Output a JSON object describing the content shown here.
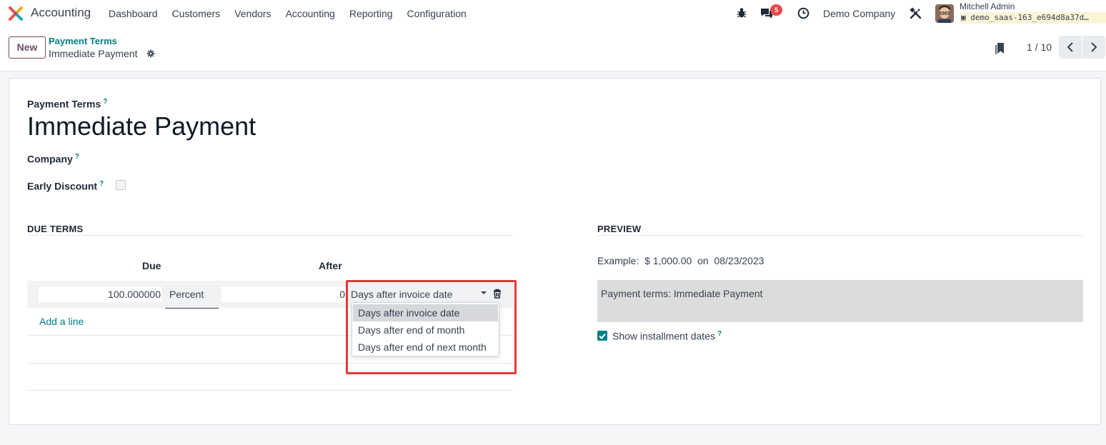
{
  "navbar": {
    "app_name": "Accounting",
    "menu": [
      "Dashboard",
      "Customers",
      "Vendors",
      "Accounting",
      "Reporting",
      "Configuration"
    ],
    "chat_badge": "5",
    "company": "Demo Company",
    "user_name": "Mitchell Admin",
    "database": "demo_saas-163_e694d8a37d…",
    "icons": [
      "app-logo",
      "bug-icon",
      "chat-icon",
      "clock-icon",
      "tools-icon",
      "avatar"
    ]
  },
  "control_panel": {
    "new_label": "New",
    "breadcrumb_parent": "Payment Terms",
    "breadcrumb_current": "Immediate Payment",
    "pager": "1 / 10"
  },
  "form": {
    "title_label": "Payment Terms",
    "title_value": "Immediate Payment",
    "company_label": "Company",
    "early_discount_label": "Early Discount",
    "early_discount_checked": false,
    "help_mark": "?"
  },
  "due_terms": {
    "section_title": "DUE TERMS",
    "col_due": "Due",
    "col_after": "After",
    "row": {
      "value": "100.000000",
      "value_type": "Percent",
      "days": "0",
      "delay_type": "Days after invoice date"
    },
    "add_line": "Add a line",
    "dropdown_options": [
      "Days after invoice date",
      "Days after end of month",
      "Days after end of next month"
    ],
    "dropdown_selected": "Days after invoice date"
  },
  "preview": {
    "section_title": "PREVIEW",
    "example_label": "Example:",
    "example_amount": "$ 1,000.00",
    "example_on": "on",
    "example_date": "08/23/2023",
    "terms_text": "Payment terms: Immediate Payment",
    "show_installments_label": "Show installment dates",
    "show_installments_checked": true
  },
  "colors": {
    "brand": "#714b67",
    "link": "#017e84",
    "highlight": "#e53935",
    "badge": "#e34b4b"
  }
}
